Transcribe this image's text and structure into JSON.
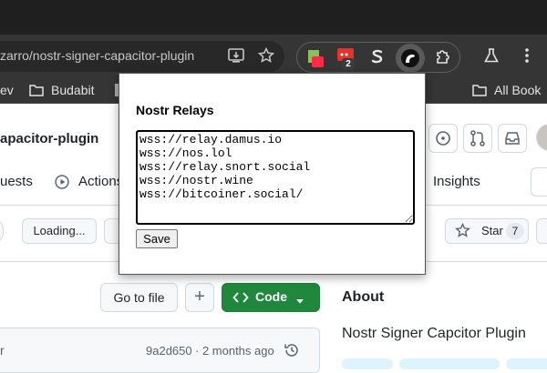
{
  "browser": {
    "url": "zarro/nostr-signer-capacitor-plugin",
    "extension_badge_count": "2",
    "bookmarks": [
      "ev",
      "Budabit",
      "All Book"
    ],
    "icons": [
      "install-app-icon",
      "star-bookmark-icon",
      "extensions-puzzle-icon",
      "labs-flask-icon",
      "kebab-menu-icon",
      "folder-icon"
    ]
  },
  "repo": {
    "name": "apacitor-plugin",
    "tabs": {
      "pull_requests": "uests",
      "actions": "Actions",
      "insights": "Insights"
    },
    "loading_button": "Loading...",
    "star_label": "Star",
    "star_count": "7",
    "goto_file": "Go to file",
    "add_button": "+",
    "code_button": "Code",
    "commit_hash": "9a2d650",
    "commit_time": "· 2 months ago",
    "commit_author_fragment": "r",
    "about_heading": "About",
    "about_description": "Nostr Signer Capcitor Plugin"
  },
  "popup": {
    "title": "Nostr Relays",
    "relays_text": "wss://relay.damus.io\nwss://nos.lol\nwss://relay.snort.social\nwss://nostr.wine\nwss://bitcoiner.social/",
    "save_label": "Save"
  },
  "colors": {
    "code_button_bg": "#1f883d",
    "chrome_toolbar": "#353535",
    "chrome_top": "#1f1f1f"
  }
}
